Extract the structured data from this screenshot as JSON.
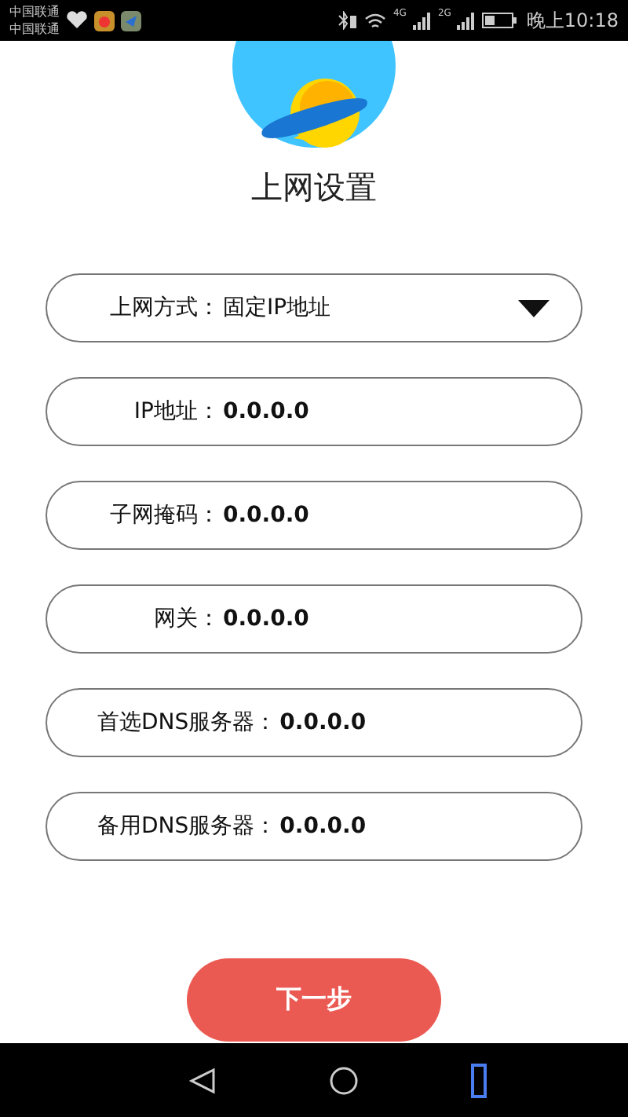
{
  "status_bar": {
    "carriers": [
      "中国联通",
      "中国联通"
    ],
    "networks": [
      "4G",
      "2G"
    ],
    "time": "晚上10:18"
  },
  "title": "上网设置",
  "fields": [
    {
      "kind": "select",
      "label": "上网方式：",
      "value": "固定IP地址"
    },
    {
      "kind": "text",
      "label": "IP地址：",
      "value": "0.0.0.0"
    },
    {
      "kind": "text",
      "label": "子网掩码：",
      "value": "0.0.0.0"
    },
    {
      "kind": "text",
      "label": "网关：",
      "value": "0.0.0.0"
    },
    {
      "kind": "text",
      "label": "首选DNS服务器：",
      "value": "0.0.0.0"
    },
    {
      "kind": "text",
      "label": "备用DNS服务器：",
      "value": "0.0.0.0"
    }
  ],
  "next_button": "下一步"
}
